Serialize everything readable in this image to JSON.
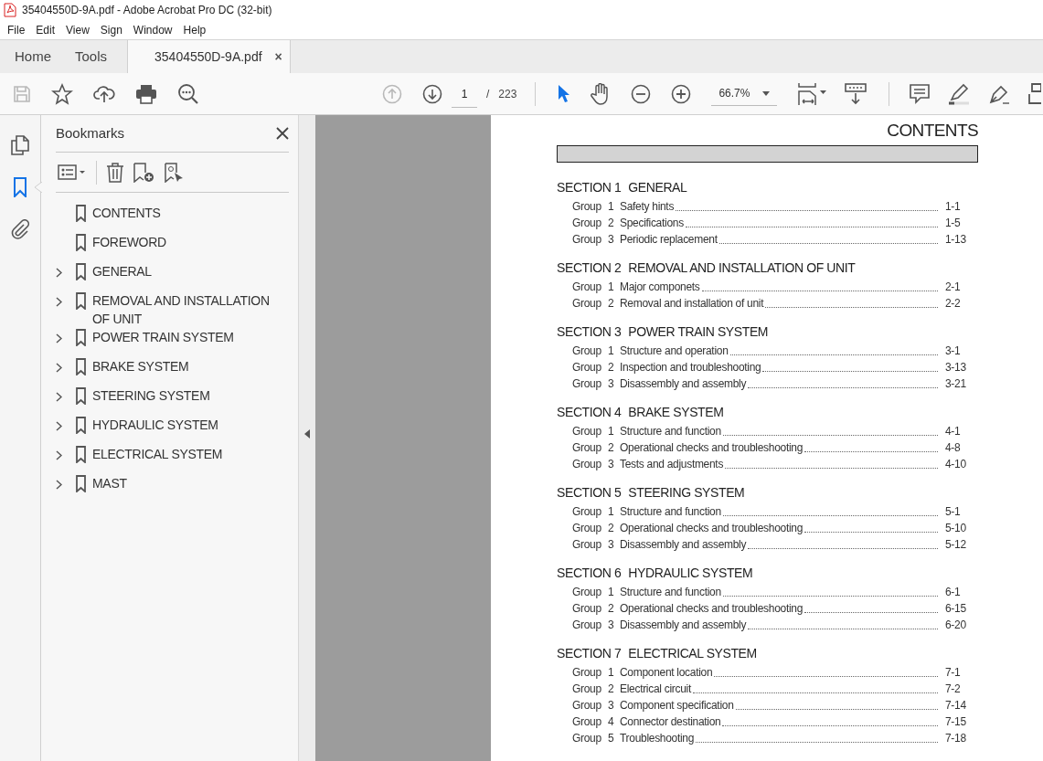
{
  "window": {
    "title": "35404550D-9A.pdf - Adobe Acrobat Pro DC (32-bit)"
  },
  "menu": [
    "File",
    "Edit",
    "View",
    "Sign",
    "Window",
    "Help"
  ],
  "tabs": [
    {
      "label": "Home",
      "selected": false
    },
    {
      "label": "Tools",
      "selected": false
    },
    {
      "label": "35404550D-9A.pdf",
      "selected": true,
      "close": "×"
    }
  ],
  "toolbar": {
    "left": [
      {
        "kind": "save",
        "disabled": true
      },
      {
        "kind": "star",
        "disabled": false
      },
      {
        "kind": "upload",
        "disabled": false
      },
      {
        "kind": "print",
        "disabled": false
      },
      {
        "kind": "search",
        "disabled": false
      }
    ],
    "nav": [
      {
        "kind": "prev",
        "disabled": true
      },
      {
        "kind": "next",
        "disabled": false
      }
    ],
    "page_current": "1",
    "page_separator": "/",
    "page_total": "223",
    "tools": [
      {
        "kind": "select",
        "selected": true
      },
      {
        "kind": "hand",
        "selected": false
      },
      {
        "kind": "zoom-out",
        "selected": false
      },
      {
        "kind": "zoom-in",
        "selected": false
      }
    ],
    "zoom": "66.7%"
  },
  "rail": [
    {
      "kind": "pages",
      "selected": false
    },
    {
      "kind": "bookmarks",
      "selected": true
    },
    {
      "kind": "attachments",
      "selected": false
    }
  ],
  "bookmarks_panel": {
    "title": "Bookmarks",
    "items": [
      {
        "label": "CONTENTS",
        "expandable": false
      },
      {
        "label": "FOREWORD",
        "expandable": false
      },
      {
        "label": "GENERAL",
        "expandable": true
      },
      {
        "label": "REMOVAL AND INSTALLATION OF UNIT",
        "expandable": true
      },
      {
        "label": "POWER TRAIN SYSTEM",
        "expandable": true
      },
      {
        "label": "BRAKE SYSTEM",
        "expandable": true
      },
      {
        "label": "STEERING SYSTEM",
        "expandable": true
      },
      {
        "label": "HYDRAULIC SYSTEM",
        "expandable": true
      },
      {
        "label": "ELECTRICAL SYSTEM",
        "expandable": true
      },
      {
        "label": "MAST",
        "expandable": true
      }
    ]
  },
  "document": {
    "heading": "CONTENTS",
    "sections": [
      {
        "label": "SECTION 1",
        "title": "GENERAL",
        "groups": [
          {
            "label": "Group",
            "number": "1",
            "title": "Safety hints",
            "page": "1-1"
          },
          {
            "label": "Group",
            "number": "2",
            "title": "Specifications",
            "page": "1-5"
          },
          {
            "label": "Group",
            "number": "3",
            "title": "Periodic replacement",
            "page": "1-13"
          }
        ]
      },
      {
        "label": "SECTION 2",
        "title": "REMOVAL AND INSTALLATION OF UNIT",
        "groups": [
          {
            "label": "Group",
            "number": "1",
            "title": "Major componets",
            "page": "2-1"
          },
          {
            "label": "Group",
            "number": "2",
            "title": "Removal and installation of unit",
            "page": "2-2"
          }
        ]
      },
      {
        "label": "SECTION 3",
        "title": "POWER TRAIN SYSTEM",
        "groups": [
          {
            "label": "Group",
            "number": "1",
            "title": "Structure and operation",
            "page": "3-1"
          },
          {
            "label": "Group",
            "number": "2",
            "title": "Inspection and troubleshooting",
            "page": "3-13"
          },
          {
            "label": "Group",
            "number": "3",
            "title": "Disassembly and assembly",
            "page": "3-21"
          }
        ]
      },
      {
        "label": "SECTION 4",
        "title": "BRAKE SYSTEM",
        "groups": [
          {
            "label": "Group",
            "number": "1",
            "title": "Structure and function",
            "page": "4-1"
          },
          {
            "label": "Group",
            "number": "2",
            "title": "Operational checks and troubleshooting",
            "page": "4-8"
          },
          {
            "label": "Group",
            "number": "3",
            "title": "Tests and adjustments",
            "page": "4-10"
          }
        ]
      },
      {
        "label": "SECTION 5",
        "title": "STEERING SYSTEM",
        "groups": [
          {
            "label": "Group",
            "number": "1",
            "title": "Structure and function",
            "page": "5-1"
          },
          {
            "label": "Group",
            "number": "2",
            "title": "Operational checks and troubleshooting",
            "page": "5-10"
          },
          {
            "label": "Group",
            "number": "3",
            "title": "Disassembly and assembly",
            "page": "5-12"
          }
        ]
      },
      {
        "label": "SECTION 6",
        "title": "HYDRAULIC SYSTEM",
        "groups": [
          {
            "label": "Group",
            "number": "1",
            "title": "Structure and function",
            "page": "6-1"
          },
          {
            "label": "Group",
            "number": "2",
            "title": "Operational checks and troubleshooting",
            "page": "6-15"
          },
          {
            "label": "Group",
            "number": "3",
            "title": "Disassembly and assembly",
            "page": "6-20"
          }
        ]
      },
      {
        "label": "SECTION 7",
        "title": "ELECTRICAL SYSTEM",
        "groups": [
          {
            "label": "Group",
            "number": "1",
            "title": "Component location",
            "page": "7-1"
          },
          {
            "label": "Group",
            "number": "2",
            "title": "Electrical circuit",
            "page": "7-2"
          },
          {
            "label": "Group",
            "number": "3",
            "title": "Component specification",
            "page": "7-14"
          },
          {
            "label": "Group",
            "number": "4",
            "title": "Connector destination",
            "page": "7-15"
          },
          {
            "label": "Group",
            "number": "5",
            "title": "Troubleshooting",
            "page": "7-18"
          }
        ]
      }
    ]
  }
}
